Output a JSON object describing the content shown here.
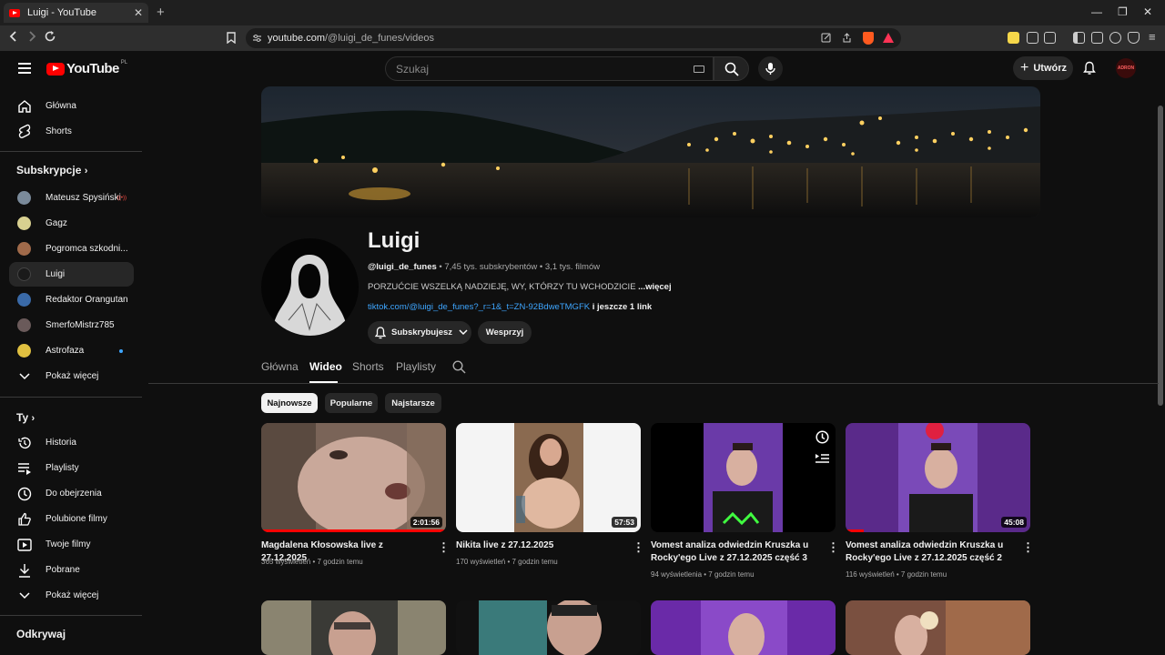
{
  "browser": {
    "tab_title": "Luigi - YouTube",
    "tab_close": "✕",
    "new_tab": "+",
    "url_host": "youtube.com",
    "url_path": "/@luigi_de_funes/videos",
    "win_min": "—",
    "win_max": "❐",
    "win_close": "✕"
  },
  "header": {
    "logo_text": "YouTube",
    "logo_country": "PL",
    "search_placeholder": "Szukaj",
    "create_label": "Utwórz",
    "avatar_text": "ADRON"
  },
  "sidebar": {
    "main": [
      {
        "label": "Główna",
        "icon": "home-icon"
      },
      {
        "label": "Shorts",
        "icon": "shorts-icon"
      }
    ],
    "subs_heading": "Subskrypcje",
    "subs": [
      {
        "label": "Mateusz Spysiński",
        "color": "#7a8a9a",
        "badge": "live"
      },
      {
        "label": "Gagz",
        "color": "#d8d090"
      },
      {
        "label": "Pogromca szkodni...",
        "color": "#a06a4a"
      },
      {
        "label": "Luigi",
        "color": "#1a1a1a"
      },
      {
        "label": "Redaktor Orangutan",
        "color": "#3a6aa8"
      },
      {
        "label": "SmerfoMistrz785",
        "color": "#6a5a5a"
      },
      {
        "label": "Astrofaza",
        "color": "#e0c040",
        "badge": "dot"
      }
    ],
    "subs_more": "Pokaż więcej",
    "you_heading": "Ty",
    "you": [
      {
        "label": "Historia",
        "icon": "history-icon"
      },
      {
        "label": "Playlisty",
        "icon": "playlists-icon"
      },
      {
        "label": "Do obejrzenia",
        "icon": "watch-later-icon"
      },
      {
        "label": "Polubione filmy",
        "icon": "thumbs-up-icon"
      },
      {
        "label": "Twoje filmy",
        "icon": "your-videos-icon"
      },
      {
        "label": "Pobrane",
        "icon": "download-icon"
      }
    ],
    "you_more": "Pokaż więcej",
    "explore_heading": "Odkrywaj"
  },
  "channel": {
    "name": "Luigi",
    "handle": "@luigi_de_funes",
    "stats": " • 7,45 tys. subskrybentów • 3,1 tys. filmów",
    "description": "PORZUĆCIE WSZELKĄ NADZIEJĘ, WY, KTÓRZY TU WCHODZICIE ",
    "more": "...więcej",
    "link": "tiktok.com/@luigi_de_funes?_r=1&_t=ZN-92BdweTMGFK",
    "link_more": " i jeszcze 1 link",
    "subscribe_label": "Subskrybujesz",
    "support_label": "Wesprzyj"
  },
  "tabs": [
    "Główna",
    "Wideo",
    "Shorts",
    "Playlisty"
  ],
  "active_tab": "Wideo",
  "chips": [
    "Najnowsze",
    "Popularne",
    "Najstarsze"
  ],
  "videos": [
    {
      "title": "Magdalena Kłosowska live z 27.12.2025",
      "views": "365 wyświetleń",
      "age": "7 godzin temu",
      "duration": "2:01:56",
      "progress": 1.0
    },
    {
      "title": "Nikita live z 27.12.2025",
      "views": "170 wyświetleń",
      "age": "7 godzin temu",
      "duration": "57:53",
      "progress": 0
    },
    {
      "title": "Vomest analiza odwiedzin Kruszka u Rocky'ego Live z 27.12.2025 część 3",
      "views": "94 wyświetlenia",
      "age": "7 godzin temu",
      "duration": "",
      "progress": 0
    },
    {
      "title": "Vomest analiza odwiedzin Kruszka u Rocky'ego Live z 27.12.2025 część 2",
      "views": "116 wyświetleń",
      "age": "7 godzin temu",
      "duration": "45:08",
      "progress": 0.1
    }
  ],
  "colors": {
    "accent": "#ff0000",
    "link": "#3ea6ff",
    "bg": "#0f0f0f"
  }
}
